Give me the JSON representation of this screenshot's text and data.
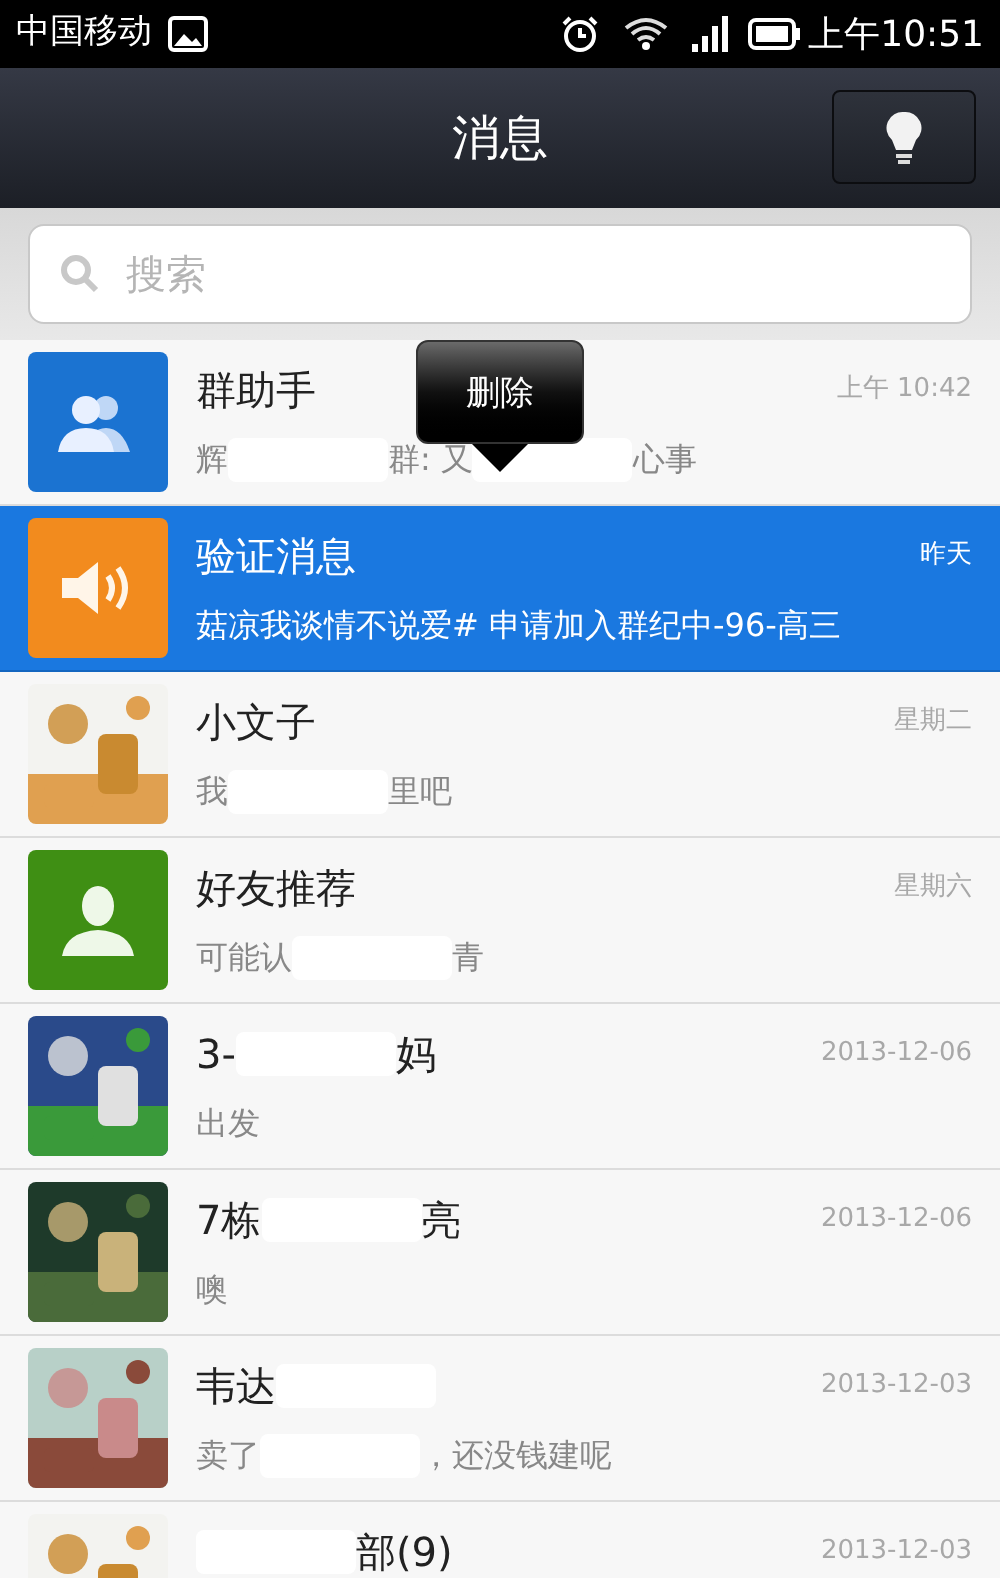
{
  "status_bar": {
    "carrier": "中国移动",
    "time": "上午10:51"
  },
  "header": {
    "title": "消息"
  },
  "search": {
    "placeholder": "搜索"
  },
  "popup": {
    "label": "删除"
  },
  "conversations": [
    {
      "kind": "group",
      "name": [
        {
          "kind": "text",
          "text": "群助手"
        }
      ],
      "preview": [
        {
          "kind": "text",
          "text": "辉"
        },
        {
          "kind": "redacted"
        },
        {
          "kind": "text",
          "text": "群: 又"
        },
        {
          "kind": "redacted"
        },
        {
          "kind": "text",
          "text": "心事"
        }
      ],
      "time": "上午 10:42",
      "selected": false
    },
    {
      "kind": "speaker",
      "name": [
        {
          "kind": "text",
          "text": "验证消息"
        }
      ],
      "preview": [
        {
          "kind": "text",
          "text": "菇凉我谈情不说爱# 申请加入群纪中-96-高三"
        }
      ],
      "time": "昨天",
      "selected": true
    },
    {
      "kind": "picture",
      "name": [
        {
          "kind": "text",
          "text": "小文子"
        }
      ],
      "preview": [
        {
          "kind": "text",
          "text": "我"
        },
        {
          "kind": "redacted"
        },
        {
          "kind": "text",
          "text": "里吧"
        }
      ],
      "time": "星期二",
      "selected": false
    },
    {
      "kind": "person",
      "name": [
        {
          "kind": "text",
          "text": "好友推荐"
        }
      ],
      "preview": [
        {
          "kind": "text",
          "text": "可能认"
        },
        {
          "kind": "redacted"
        },
        {
          "kind": "text",
          "text": "青"
        }
      ],
      "time": "星期六",
      "selected": false
    },
    {
      "kind": "picture",
      "name": [
        {
          "kind": "text",
          "text": "3-"
        },
        {
          "kind": "redacted"
        },
        {
          "kind": "text",
          "text": "妈"
        }
      ],
      "preview": [
        {
          "kind": "text",
          "text": "出发"
        }
      ],
      "time": "2013-12-06",
      "selected": false
    },
    {
      "kind": "picture",
      "name": [
        {
          "kind": "text",
          "text": "7栋"
        },
        {
          "kind": "redacted"
        },
        {
          "kind": "text",
          "text": "亮"
        }
      ],
      "preview": [
        {
          "kind": "text",
          "text": "噢"
        }
      ],
      "time": "2013-12-06",
      "selected": false
    },
    {
      "kind": "picture",
      "name": [
        {
          "kind": "text",
          "text": "韦达"
        },
        {
          "kind": "redacted"
        }
      ],
      "preview": [
        {
          "kind": "text",
          "text": "卖了"
        },
        {
          "kind": "redacted"
        },
        {
          "kind": "text",
          "text": "，还没钱建呢"
        }
      ],
      "time": "2013-12-03",
      "selected": false
    },
    {
      "kind": "picture",
      "name": [
        {
          "kind": "redacted"
        },
        {
          "kind": "text",
          "text": "部(9)"
        }
      ],
      "time": "2013-12-03",
      "selected": false
    }
  ]
}
